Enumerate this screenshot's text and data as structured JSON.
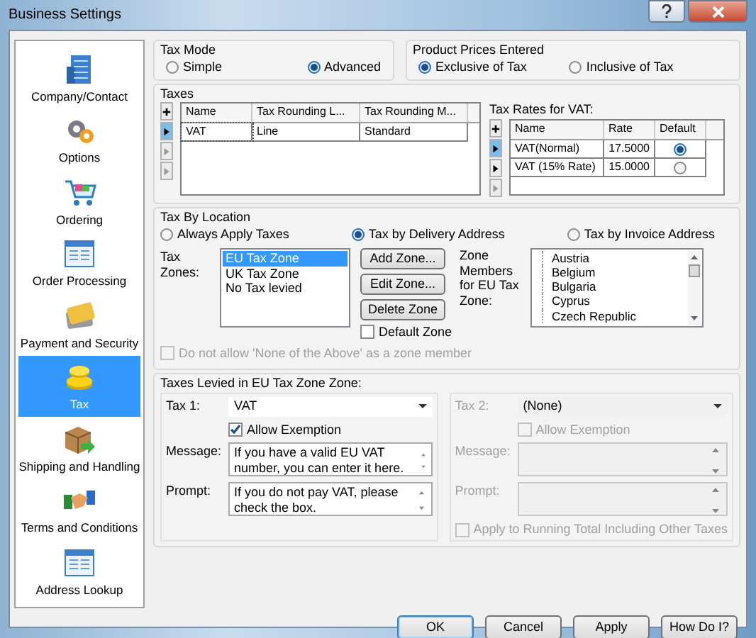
{
  "window": {
    "title": "Business Settings"
  },
  "sidebar": {
    "items": [
      {
        "label": "Company/Contact",
        "selected": false
      },
      {
        "label": "Options",
        "selected": false
      },
      {
        "label": "Ordering",
        "selected": false
      },
      {
        "label": "Order Processing",
        "selected": false
      },
      {
        "label": "Payment and Security",
        "selected": false
      },
      {
        "label": "Tax",
        "selected": true
      },
      {
        "label": "Shipping and Handling",
        "selected": false
      },
      {
        "label": "Terms and Conditions",
        "selected": false
      },
      {
        "label": "Address Lookup",
        "selected": false
      }
    ]
  },
  "tax_mode": {
    "title": "Tax Mode",
    "options": [
      {
        "label": "Simple",
        "selected": false
      },
      {
        "label": "Advanced",
        "selected": true
      }
    ]
  },
  "prices": {
    "title": "Product Prices Entered",
    "options": [
      {
        "label": "Exclusive of Tax",
        "selected": true
      },
      {
        "label": "Inclusive of Tax",
        "selected": false
      }
    ]
  },
  "taxes": {
    "title": "Taxes",
    "columns": [
      "Name",
      "Tax Rounding L...",
      "Tax Rounding M..."
    ],
    "rows": [
      {
        "cells": [
          "VAT",
          "Line",
          "Standard"
        ],
        "selected": true
      }
    ]
  },
  "rates": {
    "title": "Tax Rates for VAT:",
    "columns": [
      "Name",
      "Rate",
      "Default"
    ],
    "rows": [
      {
        "name": "VAT(Normal)",
        "rate": "17.5000",
        "default": true,
        "selected": true
      },
      {
        "name": "VAT (15% Rate)",
        "rate": "15.0000",
        "default": false,
        "selected": false
      }
    ]
  },
  "location": {
    "title": "Tax By Location",
    "options": [
      {
        "label": "Always Apply Taxes",
        "selected": false
      },
      {
        "label": "Tax by Delivery Address",
        "selected": true
      },
      {
        "label": "Tax by Invoice Address",
        "selected": false
      }
    ],
    "zones_label": "Tax Zones:",
    "zones": [
      {
        "label": "EU Tax Zone",
        "selected": true
      },
      {
        "label": "UK Tax Zone",
        "selected": false
      },
      {
        "label": "No Tax levied",
        "selected": false
      }
    ],
    "buttons": [
      "Add Zone...",
      "Edit Zone...",
      "Delete Zone"
    ],
    "default_zone": {
      "label": "Default Zone",
      "checked": false
    },
    "members_label": "Zone Members for EU Tax Zone:",
    "members": [
      "Austria",
      "Belgium",
      "Bulgaria",
      "Cyprus",
      "Czech Republic"
    ],
    "none_above": {
      "label": "Do not allow 'None of the Above' as a zone member",
      "checked": false,
      "disabled": true
    }
  },
  "levied": {
    "title": "Taxes Levied in EU Tax Zone Zone:",
    "taxes": [
      {
        "tax_label": "Tax 1:",
        "tax_value": "VAT",
        "exemption": {
          "label": "Allow Exemption",
          "checked": true
        },
        "message_label": "Message:",
        "message": "If you have a valid EU VAT number, you can enter it here.",
        "prompt_label": "Prompt:",
        "prompt": "If you do not pay VAT, please check the box.",
        "disabled": false
      },
      {
        "tax_label": "Tax 2:",
        "tax_value": "(None)",
        "exemption": {
          "label": "Allow Exemption",
          "checked": false
        },
        "message_label": "Message:",
        "prompt_label": "Prompt:",
        "disabled": true
      }
    ],
    "running_total": {
      "label": "Apply to Running Total Including Other Taxes",
      "checked": false,
      "disabled": true
    }
  },
  "buttons": [
    "OK",
    "Cancel",
    "Apply",
    "How Do I?"
  ]
}
